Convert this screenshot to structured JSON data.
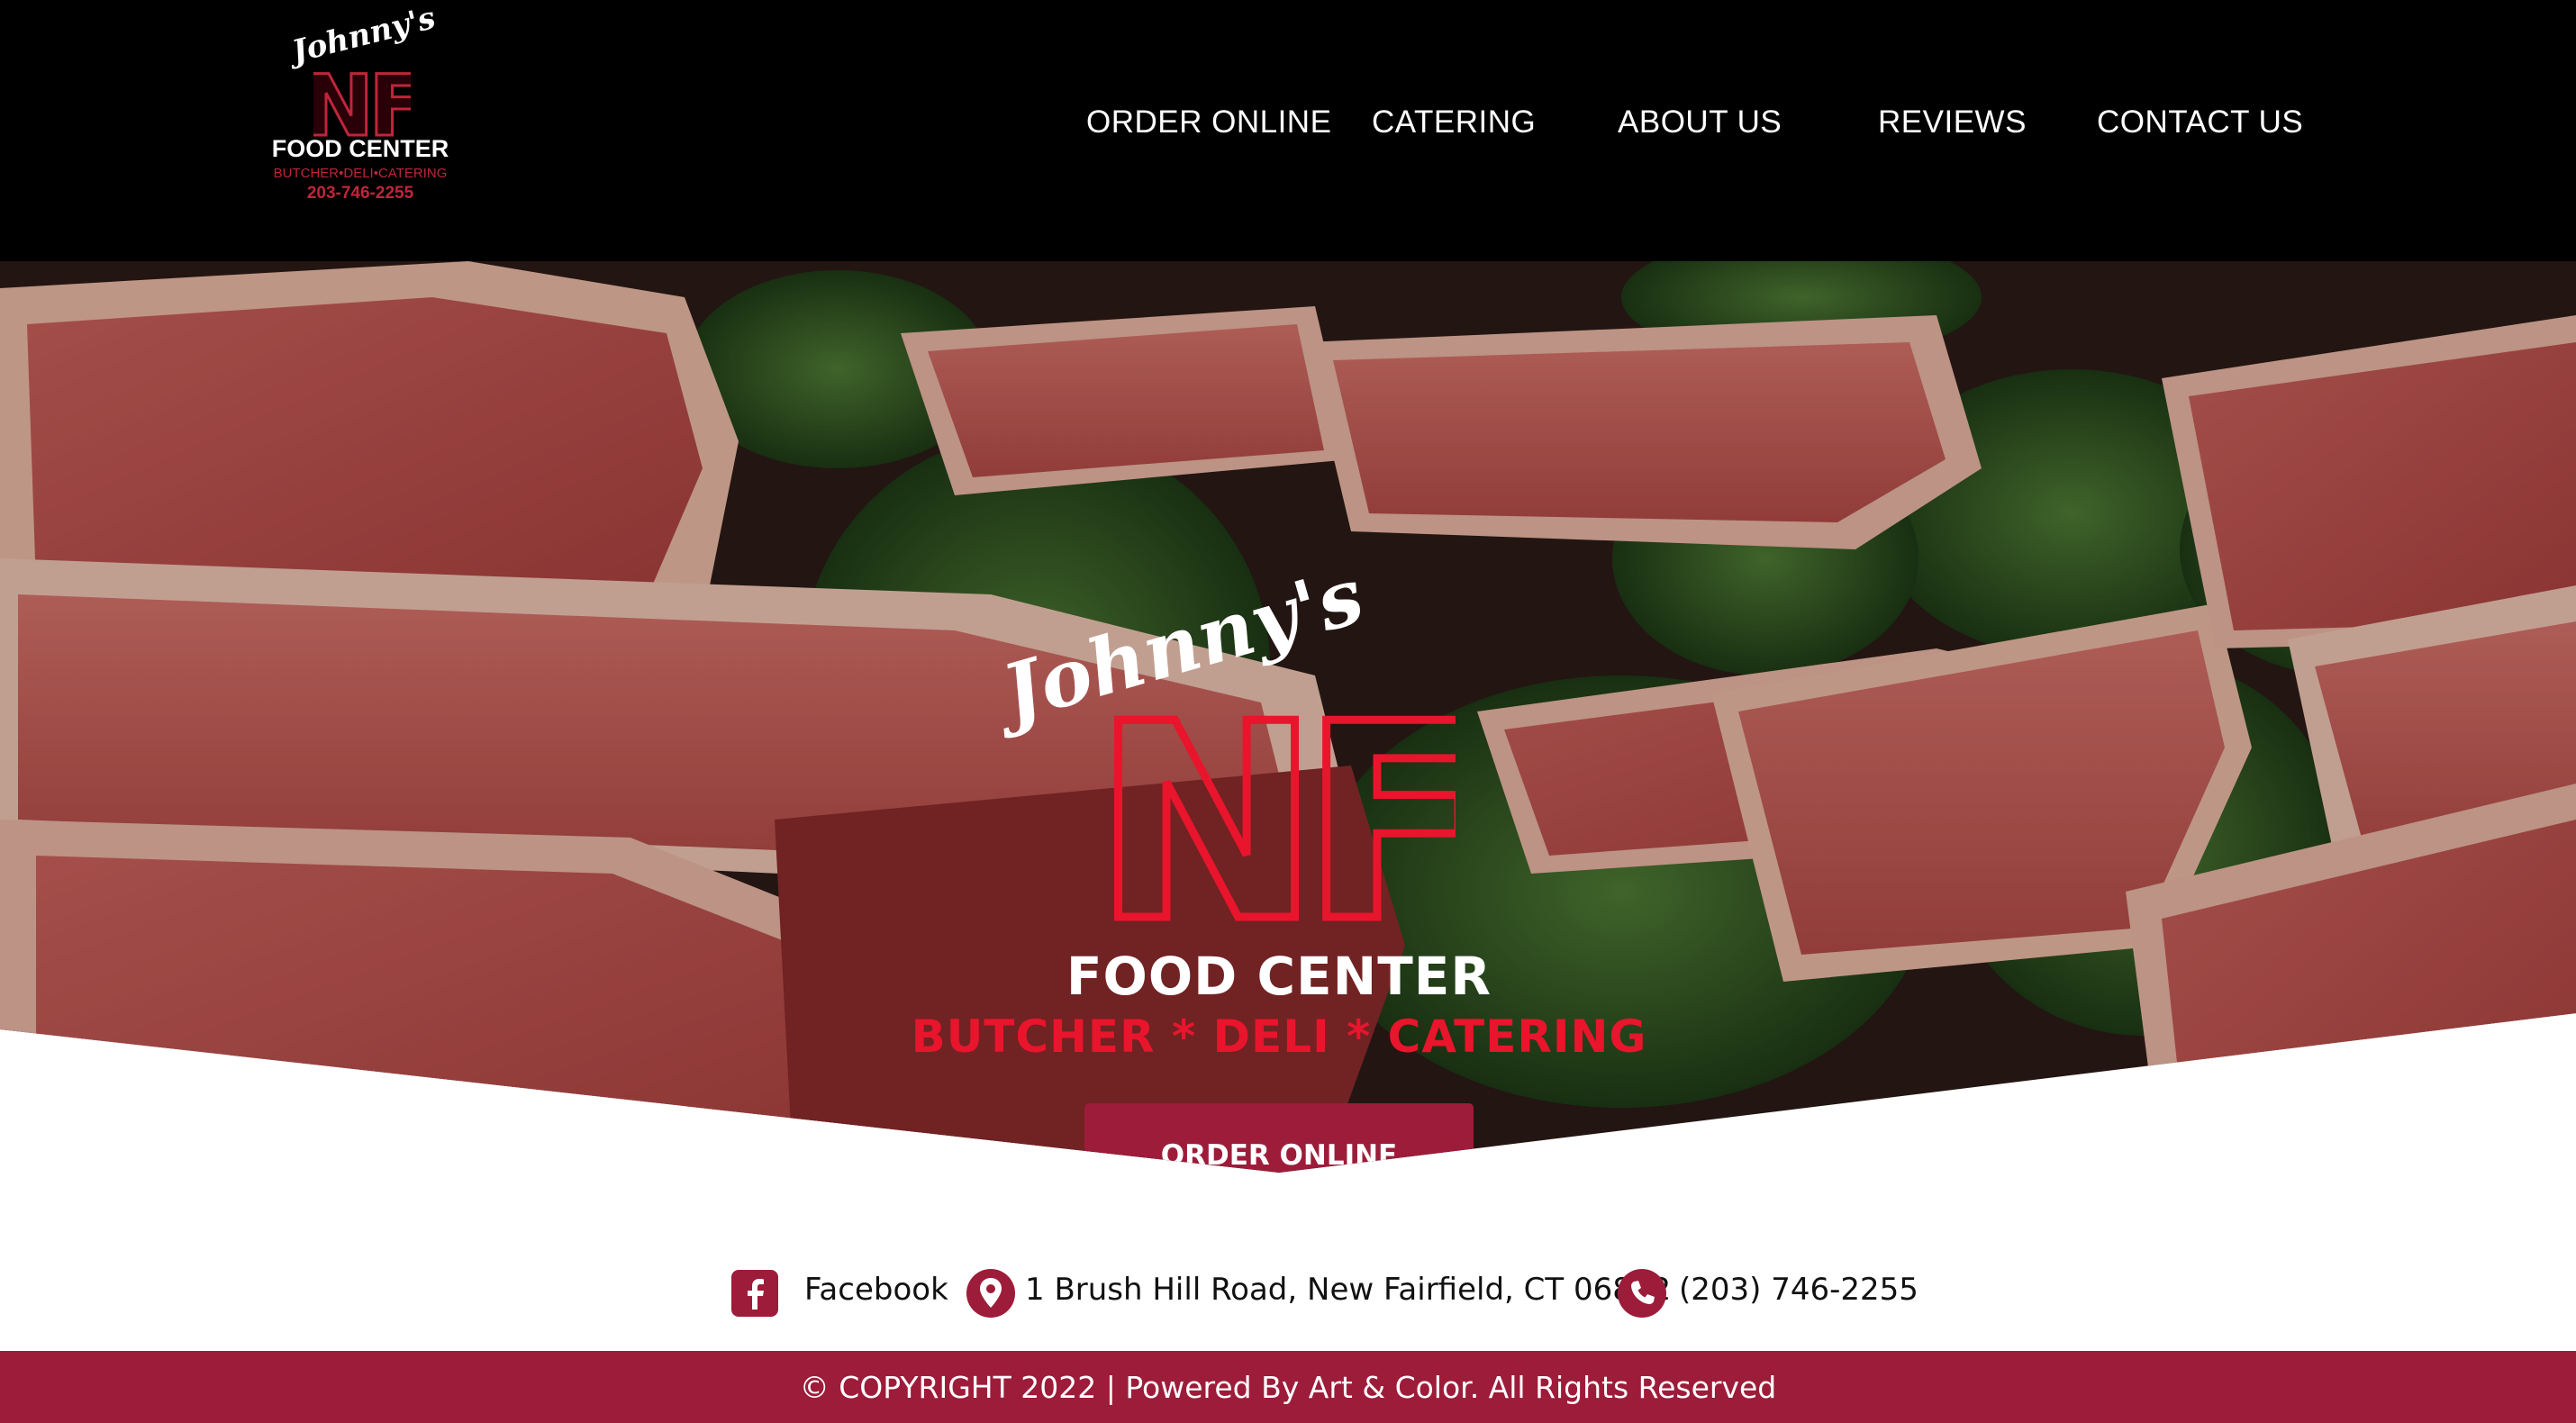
{
  "colors": {
    "header_bg": "#000000",
    "brand_red": "#e8152c",
    "brand_maroon": "#9d1c3a",
    "text_white": "#ffffff",
    "text_dark": "#111111"
  },
  "header": {
    "logo": {
      "script": "Johnny's",
      "mark": "NF",
      "title": "FOOD CENTER",
      "tagline": "BUTCHER•DELI•CATERING",
      "phone": "203-746-2255"
    },
    "nav": [
      {
        "label": "ORDER ONLINE"
      },
      {
        "label": "CATERING"
      },
      {
        "label": "ABOUT US"
      },
      {
        "label": "REVIEWS"
      },
      {
        "label": "CONTACT US"
      }
    ]
  },
  "hero": {
    "background": "meat-steaks-with-kale-photo",
    "logo_script": "Johnny's",
    "logo_mark": "NF",
    "title": "FOOD CENTER",
    "tagline": "BUTCHER * DELI * CATERING",
    "cta_label": "ORDER ONLINE"
  },
  "contact": {
    "facebook": {
      "icon": "facebook-icon",
      "label": "Facebook"
    },
    "address": {
      "icon": "map-pin-icon",
      "label": "1 Brush Hill Road, New Fairfield, CT 06812"
    },
    "phone": {
      "icon": "phone-icon",
      "label": "(203) 746-2255"
    }
  },
  "footer": {
    "copyright": "© COPYRIGHT 2022 | Powered By Art & Color. All Rights Reserved"
  }
}
